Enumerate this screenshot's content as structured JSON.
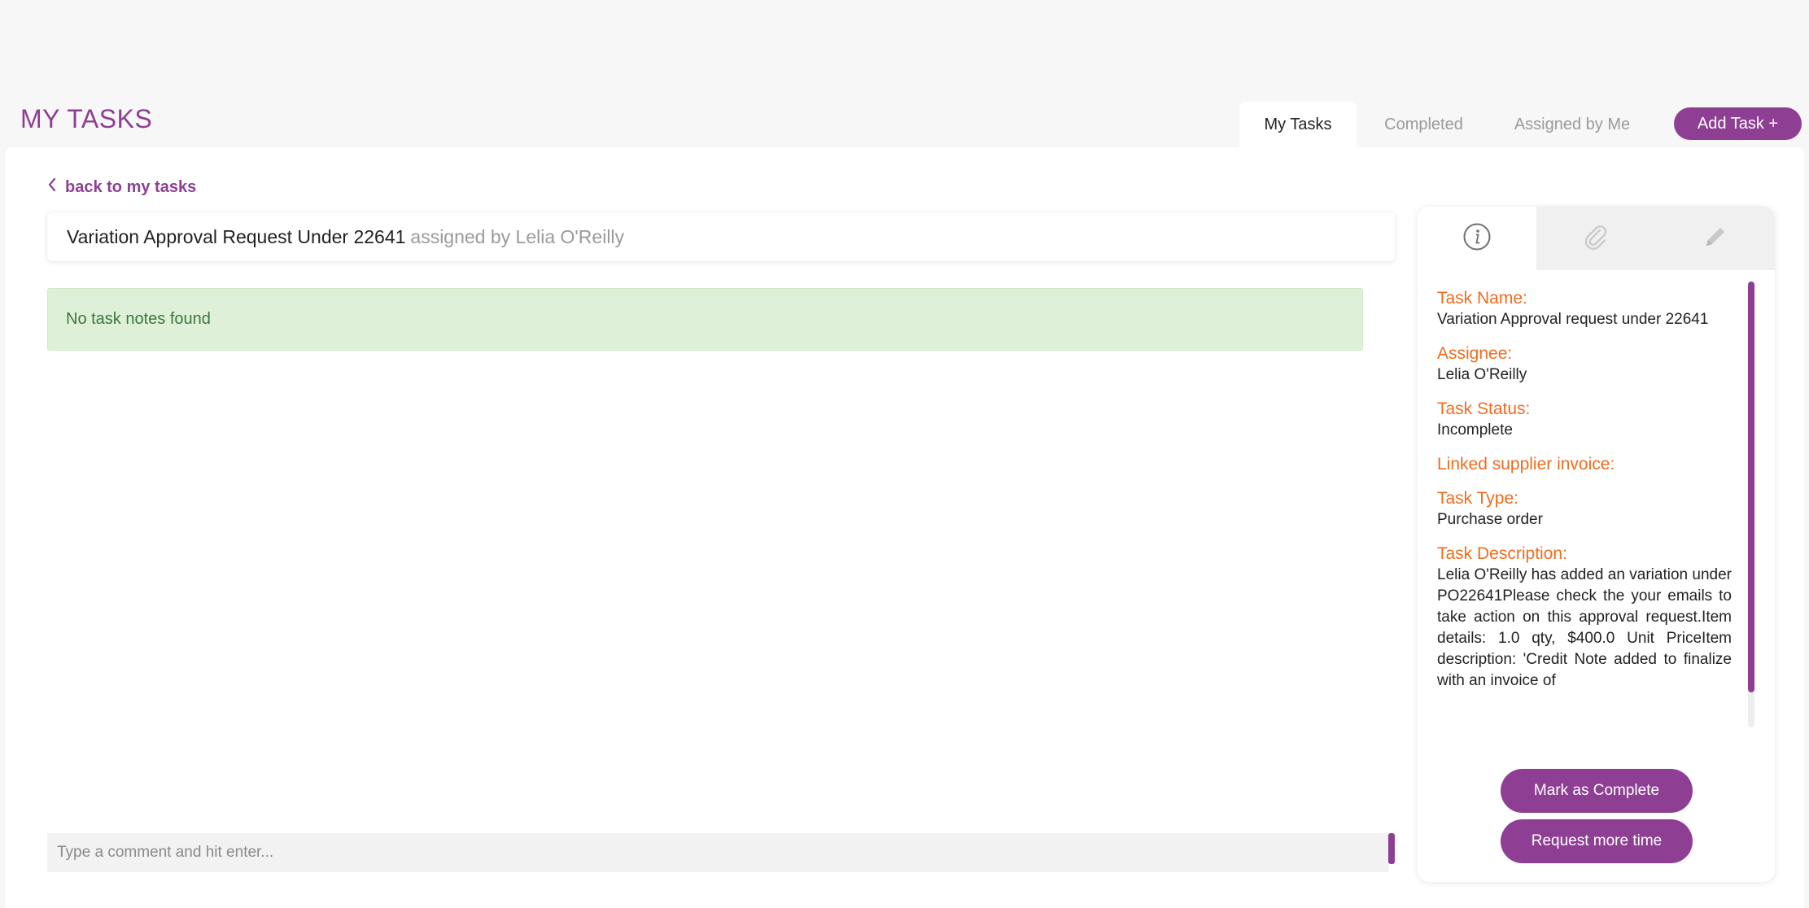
{
  "header": {
    "title": "MY TASKS",
    "tabs": [
      {
        "label": "My Tasks",
        "active": true
      },
      {
        "label": "Completed",
        "active": false
      },
      {
        "label": "Assigned by Me",
        "active": false
      }
    ],
    "add_task_label": "Add Task +"
  },
  "main": {
    "back_label": "back to my tasks",
    "task_title": "Variation Approval Request Under 22641",
    "assigned_by": "assigned by Lelia O'Reilly",
    "notes_message": "No task notes found",
    "comment_placeholder": "Type a comment and hit enter..."
  },
  "side_panel": {
    "tabs": [
      {
        "icon": "info-icon",
        "active": true
      },
      {
        "icon": "paperclip-icon",
        "active": false
      },
      {
        "icon": "pencil-icon",
        "active": false
      }
    ],
    "fields": {
      "task_name_label": "Task Name:",
      "task_name": "Variation Approval request under 22641",
      "assignee_label": "Assignee:",
      "assignee": "Lelia O'Reilly",
      "status_label": "Task Status:",
      "status": "Incomplete",
      "linked_invoice_label": "Linked supplier invoice:",
      "task_type_label": "Task Type:",
      "task_type": "Purchase order",
      "description_label": "Task Description:",
      "description": "Lelia O'Reilly has added an variation under PO22641Please check the your emails to take action on this approval request.Item details: 1.0 qty, $400.0 Unit PriceItem description: 'Credit Note added to finalize with an invoice of"
    },
    "mark_complete_label": "Mark as Complete",
    "request_time_label": "Request more time"
  },
  "colors": {
    "accent": "#8e3f94",
    "label_orange": "#f26b1d",
    "success_bg": "#dff0d8",
    "success_text": "#3c763d"
  }
}
